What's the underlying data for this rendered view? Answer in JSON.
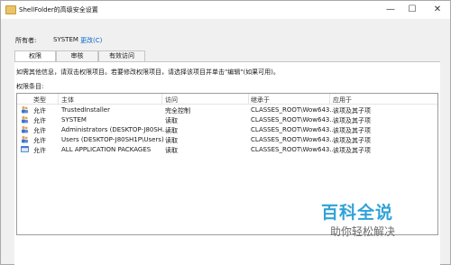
{
  "window": {
    "title": "ShellFolder的高级安全设置"
  },
  "window_controls": {
    "minimize": "—",
    "maximize": "☐",
    "close": "✕"
  },
  "owner": {
    "label": "所有者:",
    "value": "SYSTEM",
    "change_link": "更改(C)"
  },
  "tabs": [
    {
      "label": "权限"
    },
    {
      "label": "审核"
    },
    {
      "label": "有效访问"
    }
  ],
  "info_text": "如需其他信息，请双击权限项目。若要修改权限项目，请选择该项目并单击\"编辑\"(如果可用)。",
  "entries_label": "权限条目:",
  "columns": [
    "类型",
    "主体",
    "访问",
    "继承于",
    "应用于"
  ],
  "rows": [
    {
      "icon": "user-group-icon",
      "type": "允许",
      "principal": "TrustedInstaller",
      "access": "完全控制",
      "inherited": "CLASSES_ROOT\\Wow643...",
      "applies": "该项及其子项"
    },
    {
      "icon": "user-group-icon",
      "type": "允许",
      "principal": "SYSTEM",
      "access": "读取",
      "inherited": "CLASSES_ROOT\\Wow643...",
      "applies": "该项及其子项"
    },
    {
      "icon": "user-group-icon",
      "type": "允许",
      "principal": "Administrators (DESKTOP-J80SH...",
      "access": "读取",
      "inherited": "CLASSES_ROOT\\Wow643...",
      "applies": "该项及其子项"
    },
    {
      "icon": "user-group-icon",
      "type": "允许",
      "principal": "Users (DESKTOP-J80SH1P\\Users)",
      "access": "读取",
      "inherited": "CLASSES_ROOT\\Wow643...",
      "applies": "该项及其子项"
    },
    {
      "icon": "app-package-icon",
      "type": "允许",
      "principal": "ALL APPLICATION PACKAGES",
      "access": "读取",
      "inherited": "CLASSES_ROOT\\Wow643...",
      "applies": "该项及其子项"
    }
  ],
  "watermark": {
    "title": "百科全说",
    "subtitle": "助你轻松解决"
  },
  "colors": {
    "link": "#0066cc",
    "watermark_title": "#31a2d8"
  }
}
